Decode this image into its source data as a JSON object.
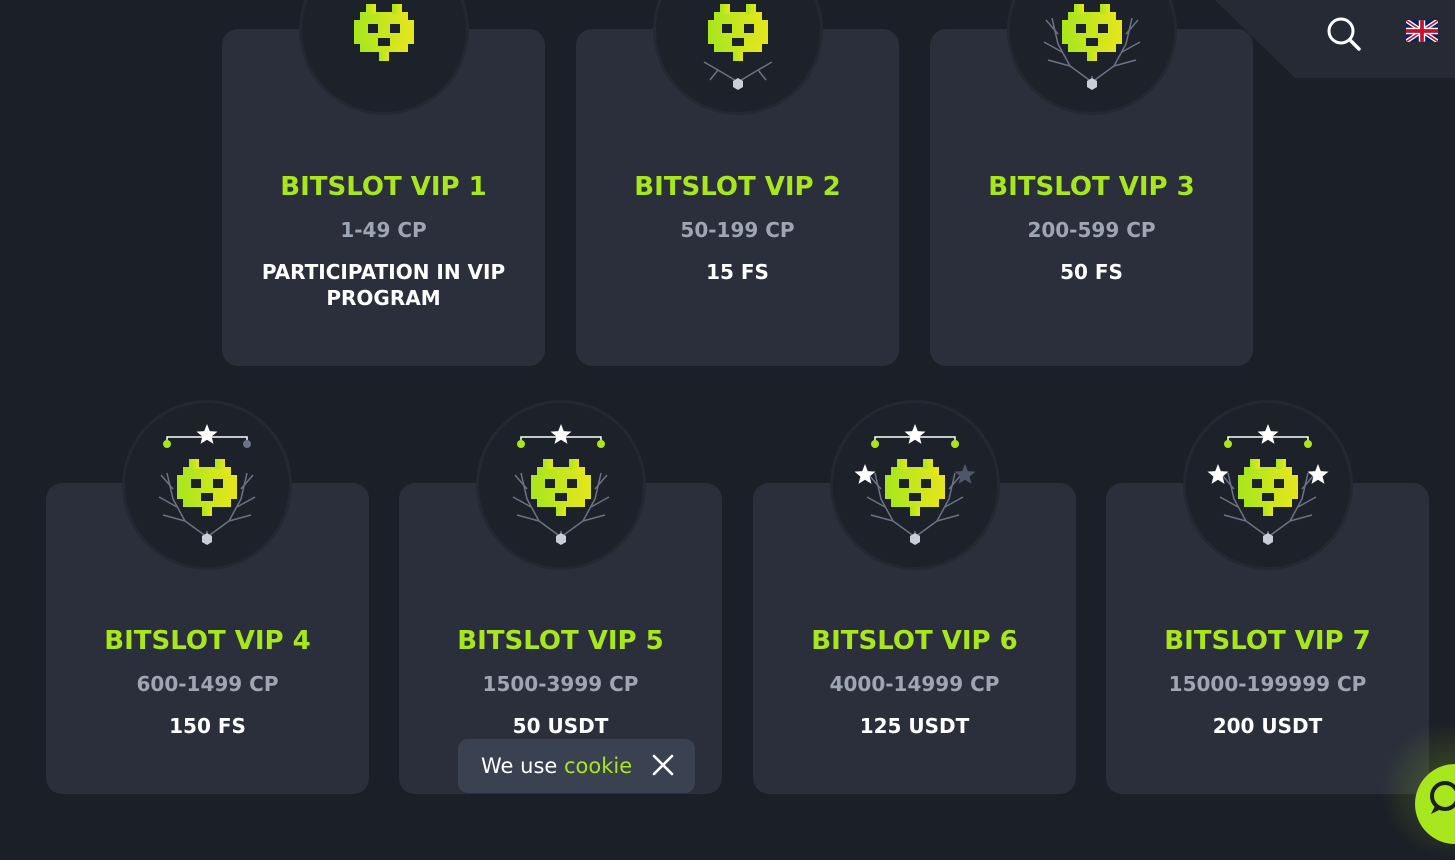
{
  "header": {
    "search_icon": "search-icon",
    "language_icon": "uk-flag-icon"
  },
  "colors": {
    "accent": "#a8e61d",
    "background": "#1b1f27",
    "card": "#2a2f3b"
  },
  "levels": [
    {
      "title": "BITSLOT VIP 1",
      "range": "1-49 CP",
      "reward": "PARTICIPATION IN VIP PROGRAM",
      "stars": 0
    },
    {
      "title": "BITSLOT VIP 2",
      "range": "50-199 CP",
      "reward": "15 FS",
      "stars": 0
    },
    {
      "title": "BITSLOT VIP 3",
      "range": "200-599 CP",
      "reward": "50 FS",
      "stars": 0
    },
    {
      "title": "BITSLOT VIP 4",
      "range": "600-1499 CP",
      "reward": "150 FS",
      "stars": 1
    },
    {
      "title": "BITSLOT VIP 5",
      "range": "1500-3999 CP",
      "reward": "50 USDT",
      "stars": 1
    },
    {
      "title": "BITSLOT VIP 6",
      "range": "4000-14999 CP",
      "reward": "125 USDT",
      "stars": 2
    },
    {
      "title": "BITSLOT VIP 7",
      "range": "15000-199999 CP",
      "reward": "200 USDT",
      "stars": 3
    }
  ],
  "cookie": {
    "text": "We use",
    "link": "cookie",
    "close_icon": "close-icon"
  },
  "chat": {
    "icon": "chat-icon"
  }
}
